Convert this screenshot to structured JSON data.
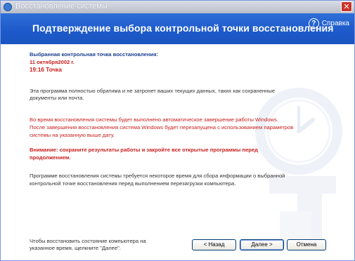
{
  "window": {
    "title": "Восстановление системы",
    "close_glyph": "✕"
  },
  "header": {
    "heading": "Подтверждение выбора контрольной точки восстановления",
    "help_glyph": "?",
    "help_label": "Справка"
  },
  "restore_point": {
    "label": "Выбранная контрольная точка восстановления:",
    "date": "11 октября2002 г.",
    "time_desc": "19:16 Точка"
  },
  "paragraphs": {
    "p1_line1": "Эта программа полностью обратима и не затронет ваших текущих данных, таких как сохраненные",
    "p1_line2": "документы или почта.",
    "p2_line1": "Во время восстановления системы будет выполнено автоматическое завершение работы Windows.",
    "p2_line2": "После завершения восстановления система Windows будет перезапущена с использованием параметров",
    "p2_line3": "системы на указанную выше дату.",
    "warning_line1": "Внимание: сохраните результаты работы и закройте все открытые программы перед",
    "warning_line2": "продолжением.",
    "p3_line1": "Программе восстановления системы требуется некоторое время для сбора информации о выбранной",
    "p3_line2": "контрольной точке восстановления перед выполнением перезагрузки компьютера.",
    "footer_line1": "Чтобы восстановить состояние компьютера на",
    "footer_line2": "указанное время, щелкните \"Далее\"."
  },
  "buttons": {
    "back": "< Назад",
    "next": "Далее >",
    "cancel": "Отмена"
  },
  "colors": {
    "header_blue": "#1d59c9",
    "title_red": "#c8201e",
    "label_blue": "#1b3f8f"
  }
}
